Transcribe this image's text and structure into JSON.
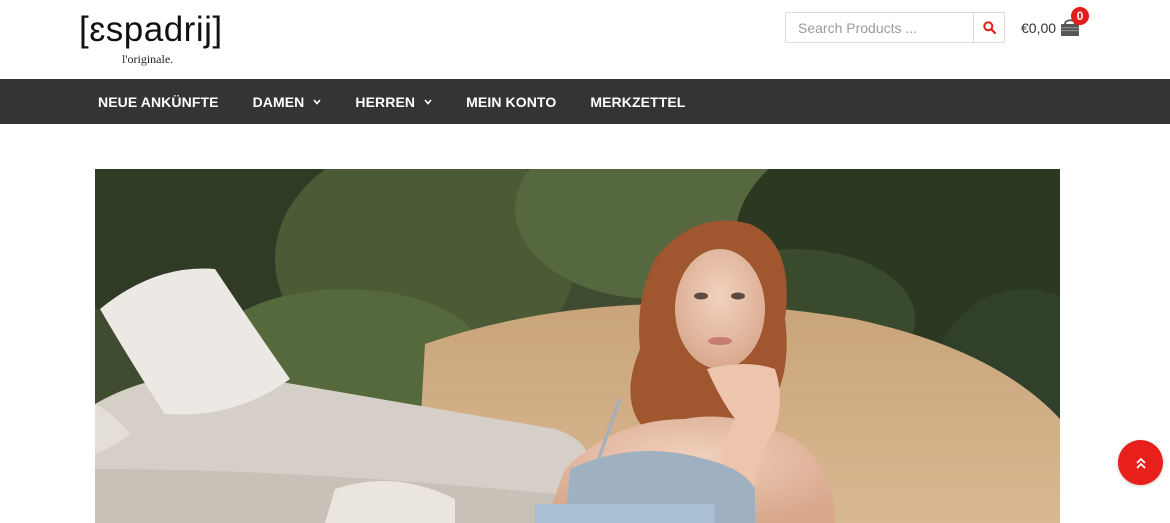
{
  "header": {
    "logo_text": "[ɛspadrij]",
    "logo_tagline": "l'originale."
  },
  "search": {
    "placeholder": "Search Products ...",
    "value": ""
  },
  "cart": {
    "total": "€0,00",
    "count": "0"
  },
  "nav": {
    "items": [
      {
        "label": "NEUE ANKÜNFTE",
        "has_dropdown": false
      },
      {
        "label": "DAMEN",
        "has_dropdown": true
      },
      {
        "label": "HERREN",
        "has_dropdown": true
      },
      {
        "label": "MEIN KONTO",
        "has_dropdown": false
      },
      {
        "label": "MERKZETTEL",
        "has_dropdown": false
      }
    ]
  },
  "colors": {
    "accent": "#e8201c",
    "nav_bg": "#333436",
    "badge": "#e11d1d"
  },
  "icons": {
    "search": "search-icon",
    "cart": "shopping-bag-icon",
    "scroll_top": "double-chevron-up-icon"
  }
}
